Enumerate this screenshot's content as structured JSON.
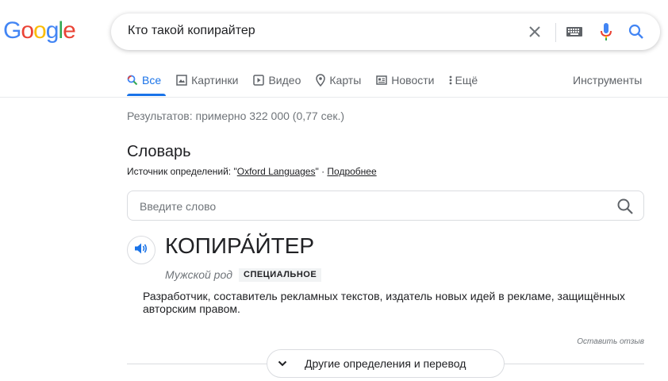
{
  "logo": {
    "letters": [
      "G",
      "o",
      "o",
      "g",
      "l",
      "e"
    ],
    "colors": [
      "#4285f4",
      "#ea4335",
      "#fbbc05",
      "#4285f4",
      "#34a853",
      "#ea4335"
    ]
  },
  "search": {
    "query": "Кто такой копирайтер"
  },
  "tabs": [
    {
      "label": "Все",
      "icon": "search-icon",
      "active": true
    },
    {
      "label": "Картинки",
      "icon": "image-icon"
    },
    {
      "label": "Видео",
      "icon": "video-icon"
    },
    {
      "label": "Карты",
      "icon": "map-pin-icon"
    },
    {
      "label": "Новости",
      "icon": "news-icon"
    },
    {
      "label": "Ещё",
      "icon": "more-vert-icon"
    }
  ],
  "tools_label": "Инструменты",
  "results_stats": "Результатов: примерно 322 000 (0,77 сек.)",
  "dictionary": {
    "title": "Словарь",
    "source_prefix": "Источник определений: \"",
    "source_name": "Oxford Languages",
    "source_suffix": "\" · ",
    "more_link": "Подробнее",
    "input_placeholder": "Введите слово",
    "headword": "КОПИРА́ЙТЕР",
    "gender": "Мужской род",
    "domain_label": "СПЕЦИАЛЬНОЕ",
    "definition": "Разработчик, составитель рекламных текстов, издатель новых идей в рекламе, защищённых авторским правом.",
    "feedback": "Оставить отзыв",
    "more_button": "Другие определения и перевод"
  },
  "colors": {
    "accent": "#1a73e8",
    "text": "#202124",
    "muted": "#70757a"
  }
}
